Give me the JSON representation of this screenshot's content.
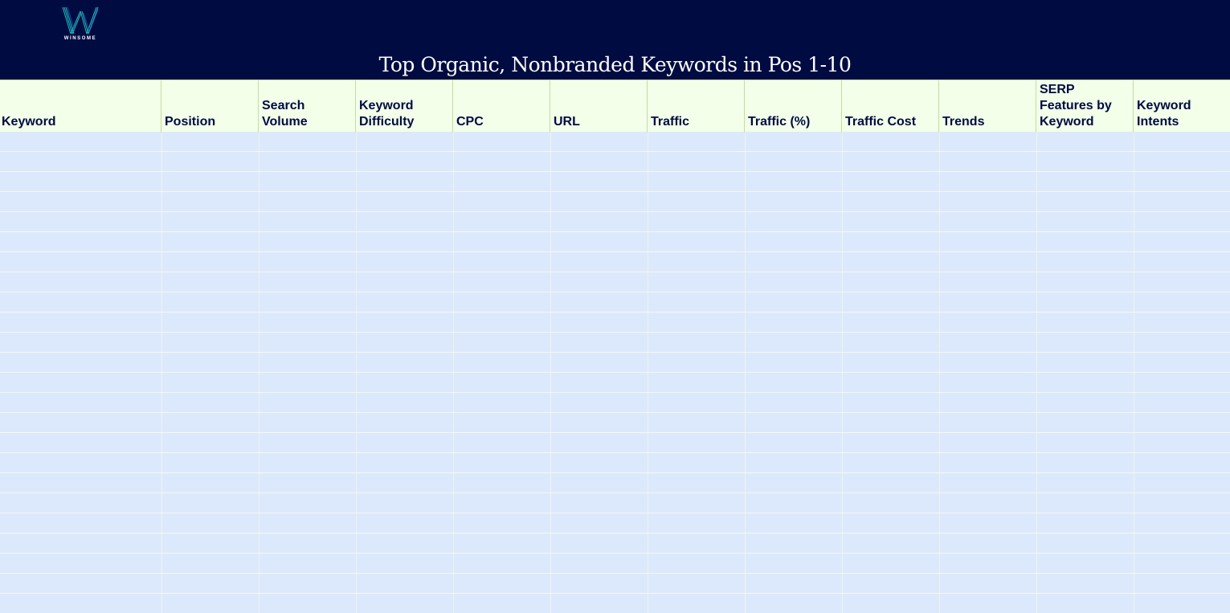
{
  "brand": {
    "logo_text": "WINSOME",
    "banner_color": "#000b42",
    "accent_color": "#1fb3b8"
  },
  "title": "Top Organic, Nonbranded Keywords in Pos 1-10",
  "table": {
    "columns": [
      "Keyword",
      "Position",
      "Search\nVolume",
      "Keyword\nDifficulty",
      "CPC",
      "URL",
      "Traffic",
      "Traffic (%)",
      "Traffic Cost",
      "Trends",
      "SERP\nFeatures by\nKeyword",
      "Keyword\nIntents"
    ],
    "header_color": "#f3ffe9",
    "row_color": "#dce9fc"
  }
}
